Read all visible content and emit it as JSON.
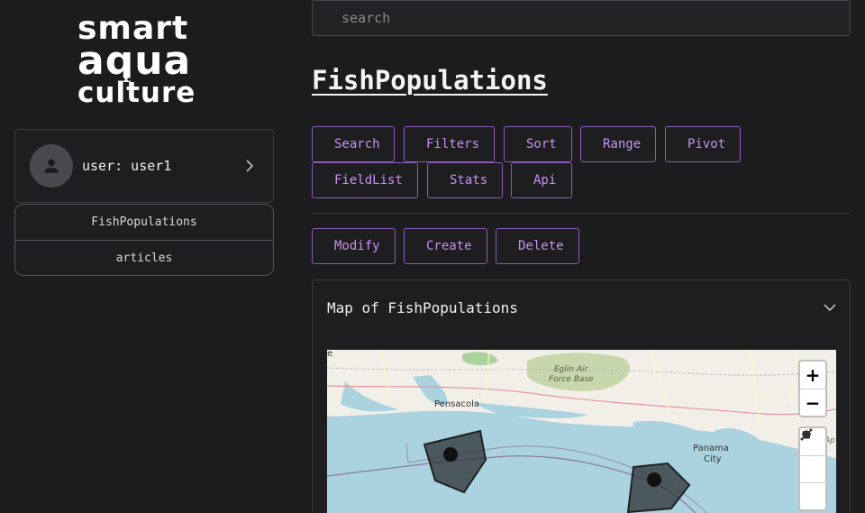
{
  "logo": {
    "line1": "smart",
    "line2": "aqua",
    "line3": "culture"
  },
  "user": {
    "label": "user: user1"
  },
  "nav": {
    "items": [
      {
        "label": "FishPopulations"
      },
      {
        "label": "articles"
      }
    ]
  },
  "search": {
    "placeholder": "search"
  },
  "page": {
    "title": "FishPopulations"
  },
  "toolbar": {
    "row1": [
      "Search",
      "Filters",
      "Sort",
      "Range",
      "Pivot"
    ],
    "row2": [
      "FieldList",
      "Stats",
      "Api"
    ],
    "row3": [
      "Modify",
      "Create",
      "Delete"
    ]
  },
  "map": {
    "title": "Map of FishPopulations",
    "zoom_in": "+",
    "zoom_out": "−",
    "labels": {
      "pensacola": "Pensacola",
      "eglin_1": "Eglin Air",
      "eglin_2": "Force Base",
      "panama_1": "Panama",
      "panama_2": "City",
      "edge_left": "e",
      "edge_right": "Ap"
    }
  },
  "colors": {
    "background": "#1c1c1e",
    "accent": "#c891f2",
    "accent_border": "#8e5bbd",
    "water": "#aad3df",
    "land": "#f2efe9",
    "polygon": "#2b2f33"
  }
}
